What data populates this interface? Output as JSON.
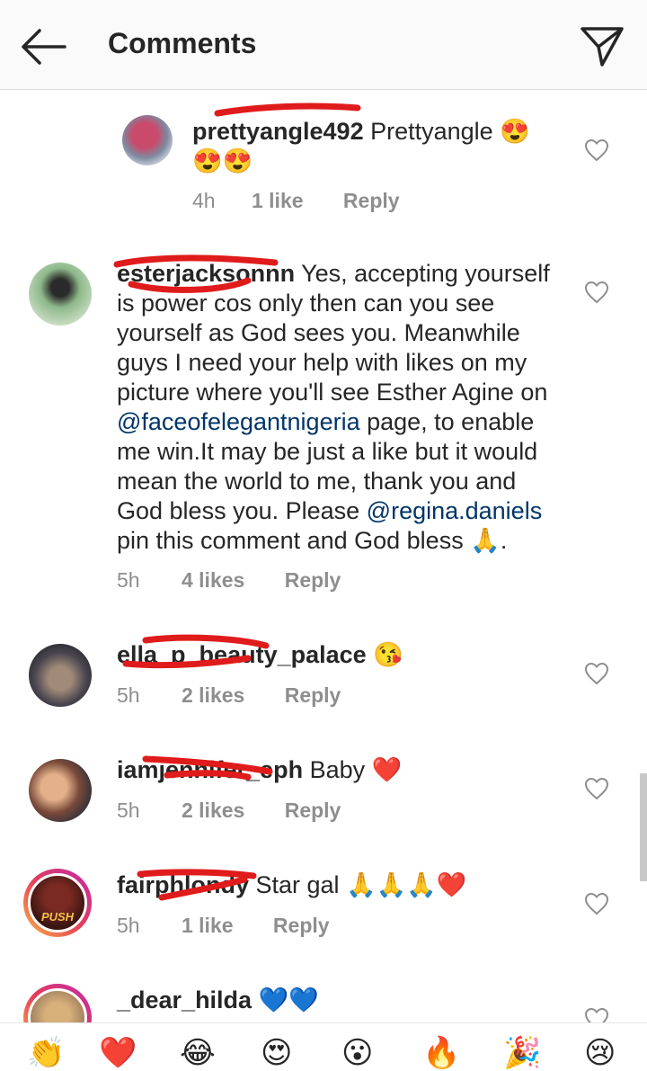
{
  "header": {
    "title": "Comments",
    "back_icon": "arrow-left-icon",
    "send_icon": "paper-plane-icon"
  },
  "comments": [
    {
      "username": "prettyangle492",
      "text": " Prettyangle 😍",
      "text_line2": "😍😍",
      "time": "4h",
      "likes": "1 like",
      "reply": "Reply"
    },
    {
      "username": "esterjacksonnn",
      "text_lines": [
        " Yes, accepting yourself",
        "is power cos only then can you see",
        "yourself as God sees you. Meanwhile",
        "guys I need your help with likes on my",
        "picture where you'll see Esther Agine on"
      ],
      "mention1": "@faceofelegantnigeria",
      "after_mention1": " page, to enable",
      "text_lines2": [
        "me win.It may be just a like but it would",
        "mean the world to me, thank you and"
      ],
      "before_mention2": "God bless you. Please ",
      "mention2": "@regina.daniels",
      "last_line": "pin this comment and God bless 🙏.",
      "time": "5h",
      "likes": "4 likes",
      "reply": "Reply"
    },
    {
      "username": "ella_p_beauty_palace",
      "text": " 😘",
      "time": "5h",
      "likes": "2 likes",
      "reply": "Reply"
    },
    {
      "username": "iamjennifer_eph",
      "text": " Baby ❤️",
      "time": "5h",
      "likes": "2 likes",
      "reply": "Reply"
    },
    {
      "username": "fairphlondy",
      "text": " Star gal 🙏🙏🙏❤️",
      "time": "5h",
      "likes": "1 like",
      "reply": "Reply",
      "avatar_text": "PUSH"
    },
    {
      "username": "_dear_hilda",
      "text": " 💙💙"
    }
  ],
  "emoji_bar": [
    "👏",
    "❤️",
    "😂",
    "😍",
    "😮",
    "🔥",
    "🎉",
    "😢"
  ],
  "colors": {
    "redaction": "#e01b1b",
    "mention": "#003569",
    "meta": "#8e8e8e"
  }
}
